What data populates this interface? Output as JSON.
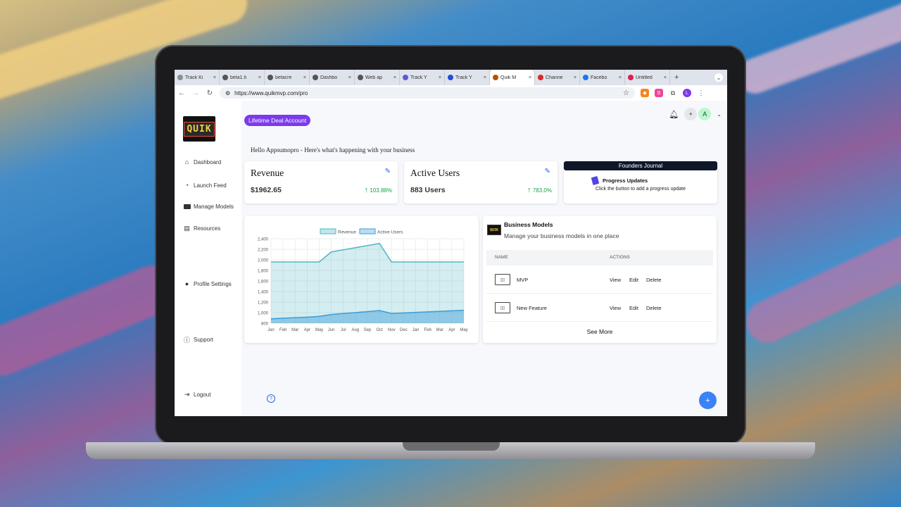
{
  "browser": {
    "tabs": [
      {
        "label": "Track Ki",
        "color": "#8a8f98"
      },
      {
        "label": "beta1.h",
        "color": "#555555"
      },
      {
        "label": "betacre",
        "color": "#555555"
      },
      {
        "label": "Dashbo",
        "color": "#555555"
      },
      {
        "label": "Web ap",
        "color": "#555555"
      },
      {
        "label": "Track Y",
        "color": "#5b5bd6"
      },
      {
        "label": "Track Y",
        "color": "#1d4ed8"
      },
      {
        "label": "Quik M",
        "color": "#b45309"
      },
      {
        "label": "Channe",
        "color": "#dc2626"
      },
      {
        "label": "Facebo",
        "color": "#1877f2"
      },
      {
        "label": "Untitled",
        "color": "#e11d48"
      }
    ],
    "active_tab_index": 7,
    "new_tab_label": "+",
    "url": "https://www.quikmvp.com/pro",
    "profile_initial": "L"
  },
  "sidebar": {
    "logo_text": "QUIK",
    "items": [
      {
        "label": "Dashboard",
        "icon": "home-icon"
      },
      {
        "label": "Launch Feed",
        "icon": "rss-icon"
      },
      {
        "label": "Manage Models",
        "icon": "briefcase-icon"
      },
      {
        "label": "Resources",
        "icon": "book-icon"
      },
      {
        "label": "Profile Settings",
        "icon": "user-circle-icon"
      },
      {
        "label": "Support",
        "icon": "help-circle-icon"
      },
      {
        "label": "Logout",
        "icon": "logout-icon"
      }
    ]
  },
  "header": {
    "badge": "Lifetime Deal Account",
    "add_label": "+",
    "avatar_initial": "A",
    "greeting": "Hello Appsumopro - Here's what's happening with your business"
  },
  "cards": {
    "revenue": {
      "title": "Revenue",
      "value": "$1962.65",
      "change": "103.88%"
    },
    "users": {
      "title": "Active Users",
      "value": "883 Users",
      "change": "783.0%"
    },
    "journal": {
      "header": "Founders Journal",
      "title": "Progress Updates",
      "subtitle": "Click the button to add a progress update"
    }
  },
  "chart_data": {
    "type": "area",
    "categories": [
      "Jan",
      "Feb",
      "Mar",
      "Apr",
      "May",
      "Jun",
      "Jul",
      "Aug",
      "Sep",
      "Oct",
      "Nov",
      "Dec",
      "Jan",
      "Feb",
      "Mar",
      "Apr",
      "May"
    ],
    "series": [
      {
        "name": "Revenue",
        "values": [
          1960,
          1960,
          1960,
          1960,
          1960,
          2150,
          2190,
          2230,
          2270,
          2310,
          1960,
          1960,
          1960,
          1960,
          1960,
          1960,
          1960
        ],
        "color": "#4fb8c4"
      },
      {
        "name": "Active Users",
        "values": [
          883,
          895,
          905,
          915,
          930,
          965,
          985,
          1000,
          1020,
          1040,
          985,
          995,
          1005,
          1015,
          1025,
          1035,
          1045
        ],
        "color": "#3b9ed8"
      }
    ],
    "ylim": [
      800,
      2400
    ],
    "yticks": [
      800,
      1000,
      1200,
      1400,
      1600,
      1800,
      2000,
      2200,
      2400
    ],
    "ytick_labels": [
      "800",
      "1,000",
      "1,200",
      "1,400",
      "1,600",
      "1,800",
      "2,000",
      "2,200",
      "2,400"
    ],
    "grid": true,
    "legend": "top"
  },
  "business_models": {
    "title": "Business Models",
    "subtitle": "Manage your business models in one place",
    "columns": [
      "NAME",
      "ACTIONS"
    ],
    "rows": [
      {
        "name": "MVP",
        "actions": [
          "View",
          "Edit",
          "Delete"
        ]
      },
      {
        "name": "New Feature",
        "actions": [
          "View",
          "Edit",
          "Delete"
        ]
      }
    ],
    "see_more": "See More"
  },
  "fab_label": "+",
  "help_label": "?"
}
